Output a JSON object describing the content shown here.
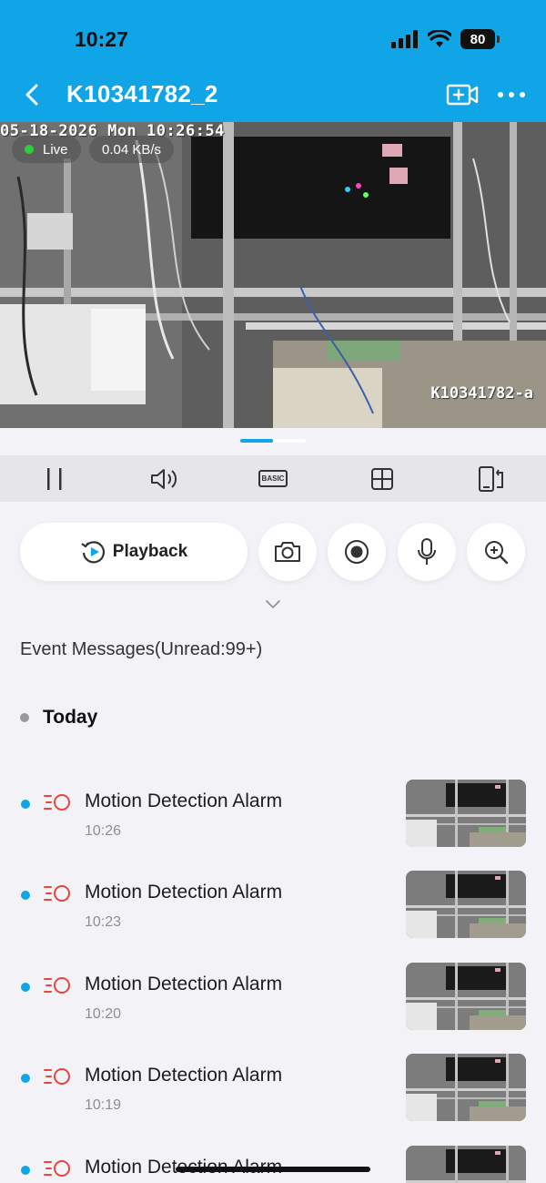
{
  "status_bar": {
    "time": "10:27",
    "battery": "80"
  },
  "nav": {
    "title": "K10341782_2"
  },
  "video": {
    "osd_date": "05-18-2026 Mon 10:26:54",
    "osd_name": "K10341782-a",
    "live_label": "Live",
    "bitrate": "0.04 KB/s"
  },
  "toolbar": {
    "quality_label": "BASIC"
  },
  "actions": {
    "playback_label": "Playback"
  },
  "events": {
    "title": "Event Messages(Unread:99+)",
    "group_label": "Today",
    "items": [
      {
        "title": "Motion Detection Alarm",
        "time": "10:26"
      },
      {
        "title": "Motion Detection Alarm",
        "time": "10:23"
      },
      {
        "title": "Motion Detection Alarm",
        "time": "10:20"
      },
      {
        "title": "Motion Detection Alarm",
        "time": "10:19"
      },
      {
        "title": "Motion Detection Alarm",
        "time": ""
      }
    ]
  },
  "colors": {
    "accent": "#0fa5e6",
    "alarm": "#e8453c",
    "live": "#2ecc40"
  }
}
